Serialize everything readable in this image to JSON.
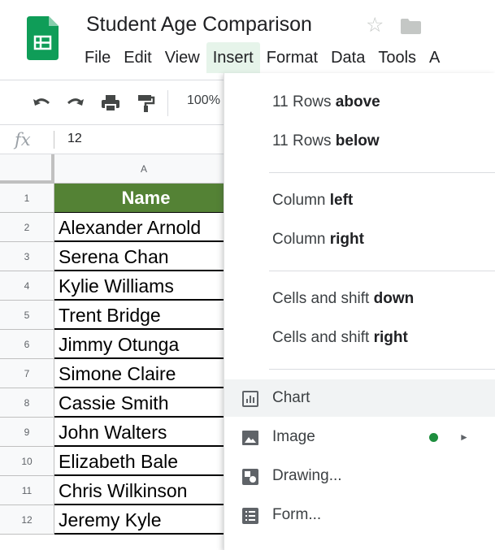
{
  "app": {
    "title": "Student Age Comparison",
    "accent_color": "#0f9d58",
    "icons": [
      "sheets-logo-icon",
      "star-icon",
      "folder-icon"
    ]
  },
  "menubar": {
    "items": [
      "File",
      "Edit",
      "View",
      "Insert",
      "Format",
      "Data",
      "Tools",
      "A"
    ],
    "active": "Insert"
  },
  "toolbar": {
    "icons": [
      "undo-icon",
      "redo-icon",
      "print-icon",
      "paint-format-icon"
    ],
    "zoom": "100%"
  },
  "formula_bar": {
    "fx_label": "fx",
    "value": "12"
  },
  "grid": {
    "column_header": "A",
    "header_fill": "#548235",
    "rows": [
      {
        "num": "1",
        "value": "Name"
      },
      {
        "num": "2",
        "value": "Alexander Arnold"
      },
      {
        "num": "3",
        "value": "Serena Chan"
      },
      {
        "num": "4",
        "value": "Kylie Williams"
      },
      {
        "num": "5",
        "value": "Trent Bridge"
      },
      {
        "num": "6",
        "value": "Jimmy Otunga"
      },
      {
        "num": "7",
        "value": "Simone Claire"
      },
      {
        "num": "8",
        "value": "Cassie Smith"
      },
      {
        "num": "9",
        "value": "John Walters"
      },
      {
        "num": "10",
        "value": "Elizabeth Bale"
      },
      {
        "num": "11",
        "value": "Chris Wilkinson"
      },
      {
        "num": "12",
        "value": "Jeremy Kyle"
      }
    ]
  },
  "insert_menu": {
    "rows_above": {
      "prefix": "11 Rows ",
      "bold": "above"
    },
    "rows_below": {
      "prefix": "11 Rows ",
      "bold": "below"
    },
    "column_left": {
      "prefix": "Column ",
      "bold": "left"
    },
    "column_right": {
      "prefix": "Column ",
      "bold": "right"
    },
    "shift_down": {
      "prefix": "Cells and shift ",
      "bold": "down"
    },
    "shift_right": {
      "prefix": "Cells and shift ",
      "bold": "right"
    },
    "chart": "Chart",
    "image": "Image",
    "drawing": "Drawing...",
    "form": "Form...",
    "submenu_arrow": "►",
    "status_dot_color": "#1e8e3e"
  }
}
